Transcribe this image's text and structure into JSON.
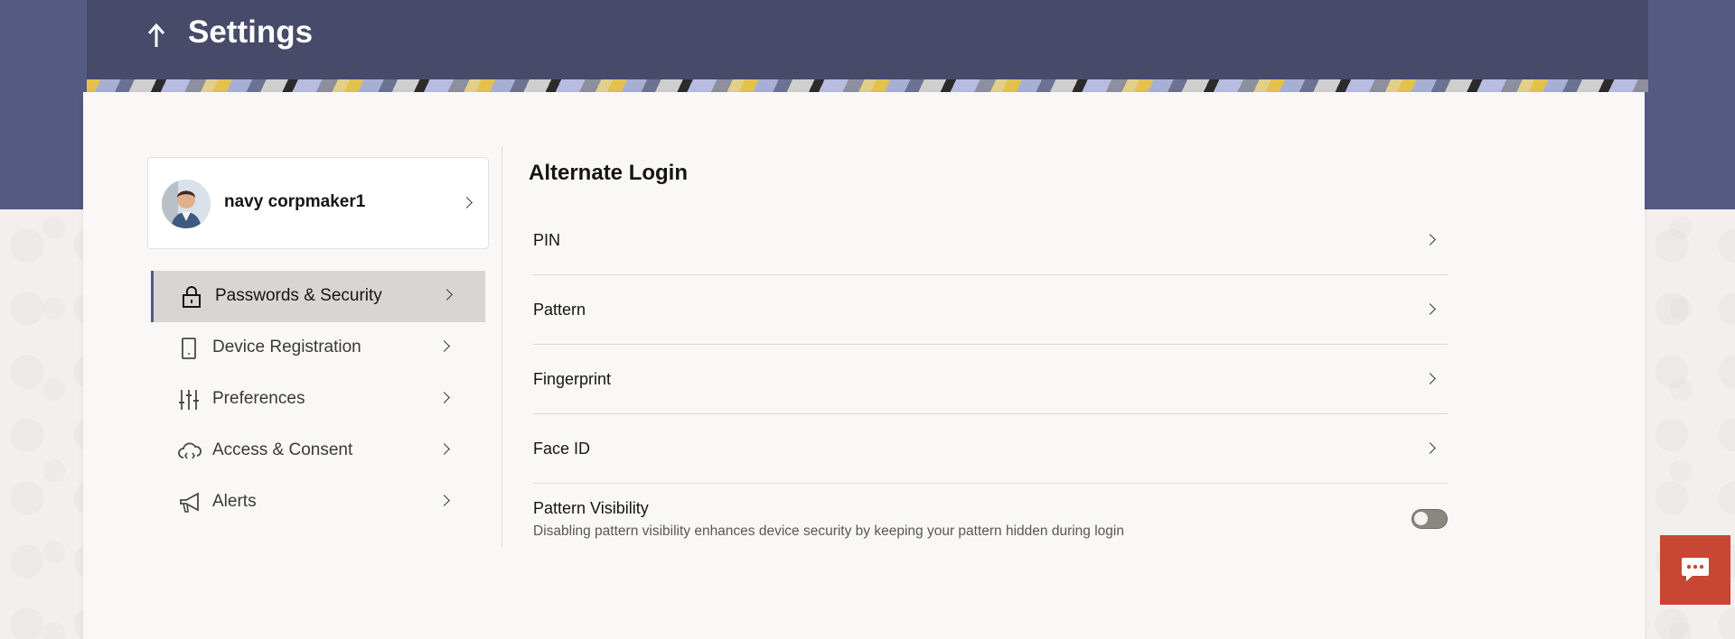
{
  "header": {
    "title": "Settings",
    "back_icon": "arrow-up-icon"
  },
  "profile": {
    "name": "navy corpmaker1",
    "avatar_icon": "user-avatar"
  },
  "nav": {
    "items": [
      {
        "label": "Passwords & Security",
        "icon": "lock-icon",
        "active": true
      },
      {
        "label": "Device Registration",
        "icon": "phone-icon",
        "active": false
      },
      {
        "label": "Preferences",
        "icon": "sliders-icon",
        "active": false
      },
      {
        "label": "Access & Consent",
        "icon": "cloud-icon",
        "active": false
      },
      {
        "label": "Alerts",
        "icon": "megaphone-icon",
        "active": false
      }
    ]
  },
  "section": {
    "title": "Alternate Login",
    "options": [
      {
        "label": "PIN"
      },
      {
        "label": "Pattern"
      },
      {
        "label": "Fingerprint"
      },
      {
        "label": "Face ID"
      }
    ],
    "visibility": {
      "title": "Pattern Visibility",
      "description": "Disabling pattern visibility enhances device security by keeping your pattern hidden during login",
      "enabled": false
    }
  },
  "colors": {
    "header": "#474a68",
    "band": "#545a82",
    "chat": "#c74634"
  },
  "chat": {
    "icon": "chat-icon"
  }
}
